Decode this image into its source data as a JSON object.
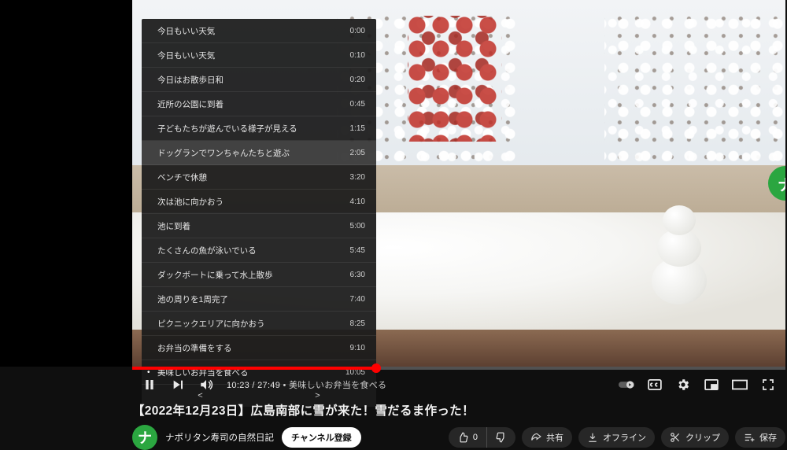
{
  "chapters": [
    {
      "label": "今日もいい天気",
      "time": "0:00"
    },
    {
      "label": "今日もいい天気",
      "time": "0:10"
    },
    {
      "label": "今日はお散歩日和",
      "time": "0:20"
    },
    {
      "label": "近所の公園に到着",
      "time": "0:45"
    },
    {
      "label": "子どもたちが遊んでいる様子が見える",
      "time": "1:15"
    },
    {
      "label": "ドッグランでワンちゃんたちと遊ぶ",
      "time": "2:05"
    },
    {
      "label": "ベンチで休憩",
      "time": "3:20"
    },
    {
      "label": "次は池に向かおう",
      "time": "4:10"
    },
    {
      "label": "池に到着",
      "time": "5:00"
    },
    {
      "label": "たくさんの魚が泳いでいる",
      "time": "5:45"
    },
    {
      "label": "ダックボートに乗って水上散歩",
      "time": "6:30"
    },
    {
      "label": "池の周りを1周完了",
      "time": "7:40"
    },
    {
      "label": "ピクニックエリアに向かおう",
      "time": "8:25"
    },
    {
      "label": "お弁当の準備をする",
      "time": "9:10"
    },
    {
      "label": "美味しいお弁当を食べる",
      "time": "10:05"
    }
  ],
  "chapter_nav": {
    "prev": "<",
    "next": ">"
  },
  "chapter_state": {
    "hovered_index": 5,
    "current_index": 14
  },
  "player": {
    "elapsed": "10:23",
    "total": "27:49",
    "separator": " / ",
    "chapter_prefix": " • ",
    "current_chapter": "美味しいお弁当を食べる",
    "progress_percent": 37.4
  },
  "video": {
    "title": "【2022年12月23日】広島南部に雪が来た！雪だるま作った！"
  },
  "channel": {
    "name": "ナポリタン寿司の自然日記",
    "avatar_initial": "ナ",
    "subscribe_label": "チャンネル登録"
  },
  "actions": {
    "like_count": "0",
    "share": "共有",
    "offline": "オフライン",
    "clip": "クリップ",
    "save": "保存"
  },
  "badge": {
    "initial": "ナ"
  }
}
